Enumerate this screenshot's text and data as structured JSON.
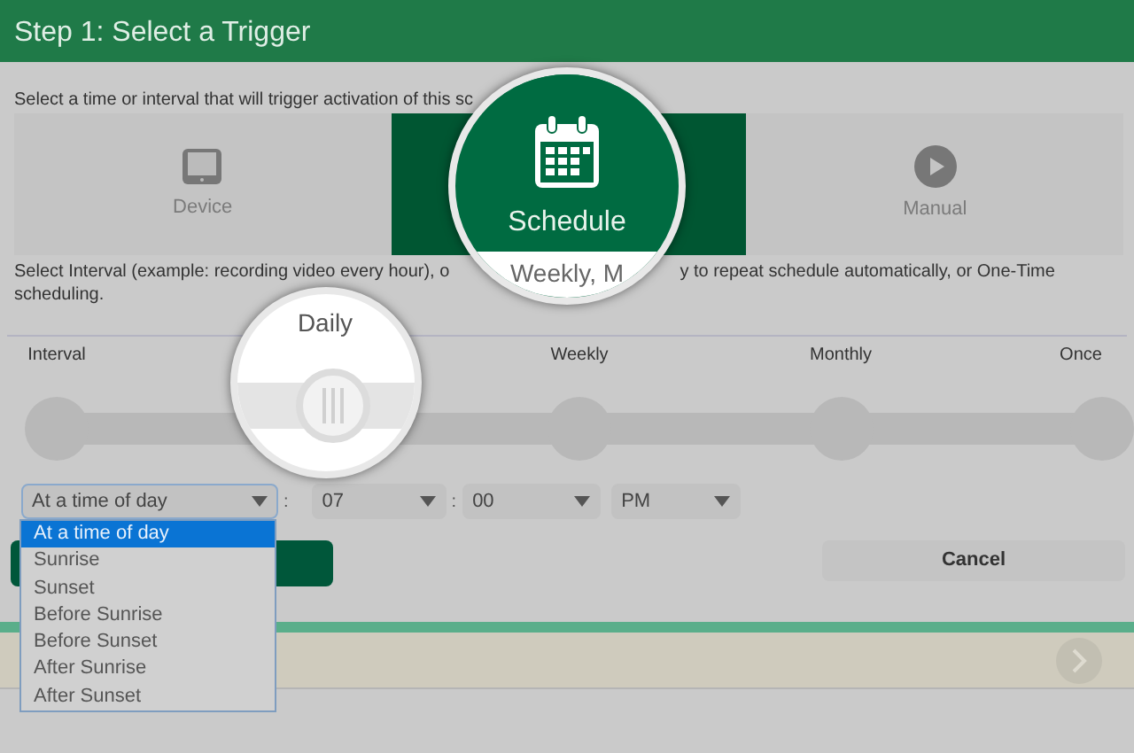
{
  "header": {
    "title": "Step 1: Select a Trigger"
  },
  "intro_text": "Select a time or interval that will trigger activation of this sc",
  "trigger_tiles": [
    {
      "label": "Device",
      "kind": "device",
      "selected": false
    },
    {
      "label": "Schedule",
      "kind": "schedule",
      "selected": true
    },
    {
      "label": "Manual",
      "kind": "manual",
      "selected": false
    }
  ],
  "interval_text": [
    "Select Interval (example: recording video every hour), o",
    "y to repeat schedule automatically, or One-Time",
    "scheduling."
  ],
  "magnified_text": "Weekly, M",
  "interval_slider": {
    "stops": [
      {
        "label": "Interval",
        "selected": false
      },
      {
        "label": "Daily",
        "selected": true
      },
      {
        "label": "Weekly",
        "selected": false
      },
      {
        "label": "Monthly",
        "selected": false
      },
      {
        "label": "Once",
        "selected": false
      }
    ]
  },
  "time_selects": [
    {
      "value": "At a time of day",
      "expanded": true
    },
    {
      "value": "07",
      "expanded": false
    },
    {
      "value": "00",
      "expanded": false
    },
    {
      "value": "PM",
      "expanded": false
    }
  ],
  "separators": [
    ":",
    ":"
  ],
  "dropdown_options": [
    {
      "label": "At a time of day",
      "selected": true
    },
    {
      "label": "Sunrise",
      "selected": false
    },
    {
      "label": "Sunset",
      "selected": false
    },
    {
      "label": "Before Sunrise",
      "selected": false
    },
    {
      "label": "Before Sunset",
      "selected": false
    },
    {
      "label": "After Sunrise",
      "selected": false
    },
    {
      "label": "After Sunset",
      "selected": false
    }
  ],
  "action_buttons": [
    {
      "kind": "primary"
    },
    {
      "kind": "secondary",
      "label": "Cancel"
    }
  ]
}
